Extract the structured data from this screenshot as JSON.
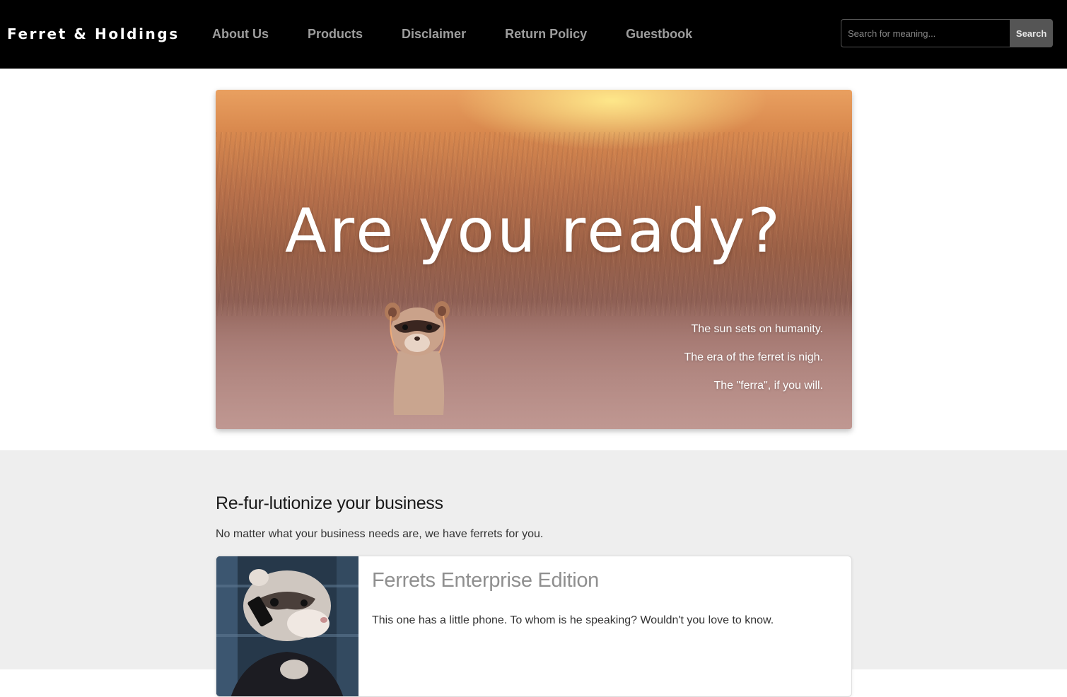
{
  "navbar": {
    "brand": "Ferret & Holdings",
    "links": [
      {
        "label": "About Us"
      },
      {
        "label": "Products"
      },
      {
        "label": "Disclaimer"
      },
      {
        "label": "Return Policy"
      },
      {
        "label": "Guestbook"
      }
    ],
    "search": {
      "placeholder": "Search for meaning...",
      "value": "",
      "button_label": "Search"
    }
  },
  "hero": {
    "title": "Are you ready?",
    "lines": [
      "The sun sets on humanity.",
      "The era of the ferret is nigh.",
      "The \"ferra\", if you will."
    ]
  },
  "section": {
    "heading": "Re-fur-lutionize your business",
    "text": "No matter what your business needs are, we have ferrets for you."
  },
  "products": [
    {
      "title": "Ferrets Enterprise Edition",
      "description": "This one has a little phone. To whom is he speaking? Wouldn't you love to know."
    }
  ],
  "colors": {
    "navbar_bg": "#000000",
    "nav_link": "#9d9d9d",
    "section_bg": "#eeeeee",
    "product_title": "#8f8f8f"
  }
}
